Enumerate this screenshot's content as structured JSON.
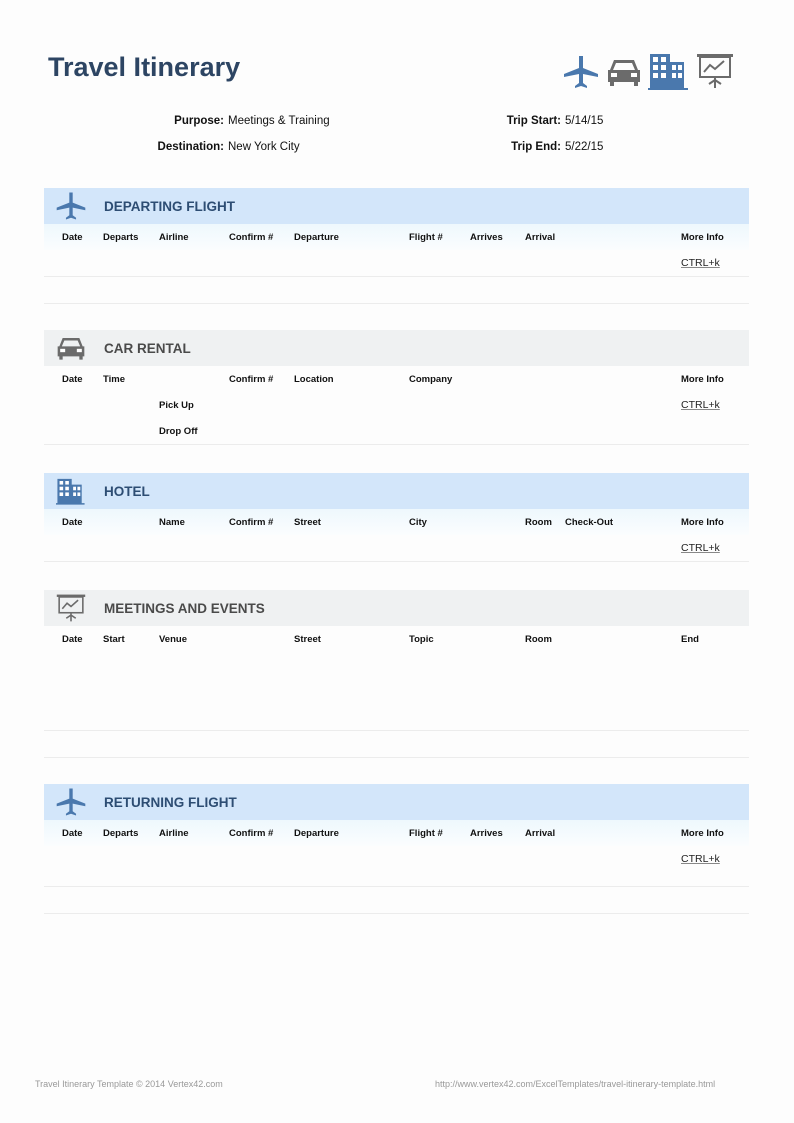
{
  "header": {
    "title": "Travel Itinerary",
    "icons": [
      "airplane-icon",
      "car-icon",
      "building-icon",
      "presentation-icon"
    ]
  },
  "trip": {
    "purpose_label": "Purpose:",
    "purpose": "Meetings & Training",
    "destination_label": "Destination:",
    "destination": "New York City",
    "start_label": "Trip Start:",
    "start": "5/14/15",
    "end_label": "Trip End:",
    "end": "5/22/15"
  },
  "colors": {
    "title": "#2d4563",
    "blue_header": "#d3e6fa",
    "gray_header": "#eff1f2",
    "icon_blue": "#4a78ad",
    "icon_gray": "#6b6b6b"
  },
  "departing": {
    "title": "DEPARTING FLIGHT",
    "columns": [
      "Date",
      "Departs",
      "Airline",
      "Confirm #",
      "Departure",
      "Flight #",
      "Arrives",
      "Arrival",
      "More Info"
    ],
    "link": "CTRL+k"
  },
  "car": {
    "title": "CAR RENTAL",
    "columns": [
      "Date",
      "Time",
      "Confirm #",
      "Location",
      "Company",
      "More Info"
    ],
    "pickup": "Pick Up",
    "dropoff": "Drop Off",
    "link": "CTRL+k"
  },
  "hotel": {
    "title": "HOTEL",
    "columns": [
      "Date",
      "Name",
      "Confirm #",
      "Street",
      "City",
      "Room",
      "Check-Out",
      "More Info"
    ],
    "link": "CTRL+k"
  },
  "meetings": {
    "title": "MEETINGS AND EVENTS",
    "columns": [
      "Date",
      "Start",
      "Venue",
      "Street",
      "Topic",
      "Room",
      "End"
    ]
  },
  "returning": {
    "title": "RETURNING FLIGHT",
    "columns": [
      "Date",
      "Departs",
      "Airline",
      "Confirm #",
      "Departure",
      "Flight #",
      "Arrives",
      "Arrival",
      "More Info"
    ],
    "link": "CTRL+k"
  },
  "footer": {
    "left": "Travel Itinerary Template © 2014 Vertex42.com",
    "right": "http://www.vertex42.com/ExcelTemplates/travel-itinerary-template.html"
  }
}
